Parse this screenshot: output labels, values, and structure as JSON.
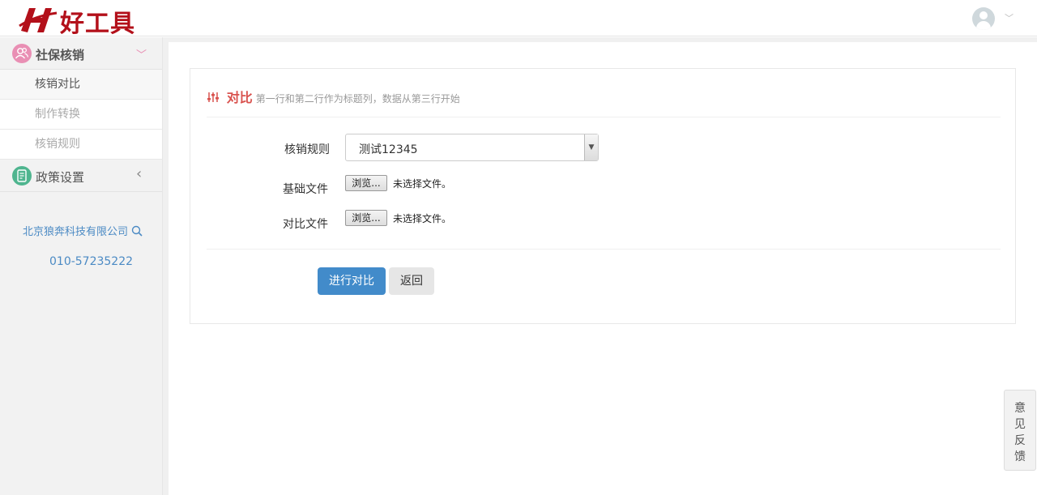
{
  "header": {
    "logo_text": "好工具",
    "logo_mark": "H"
  },
  "sidebar": {
    "groups": [
      {
        "label": "社保核销",
        "icon": "user-group-icon",
        "icon_color": "#e98fb4",
        "arrow": "﹀"
      },
      {
        "label": "政策设置",
        "icon": "document-icon",
        "icon_color": "#4fb58f",
        "arrow": "‹"
      }
    ],
    "items": [
      {
        "label": "核销对比",
        "active": true
      },
      {
        "label": "制作转换",
        "active": false
      },
      {
        "label": "核销规则",
        "active": false
      }
    ],
    "company": "北京狼奔科技有限公司",
    "phone": "010-57235222"
  },
  "panel": {
    "title": "对比",
    "subtitle": "第一行和第二行作为标题列，数据从第三行开始",
    "form": {
      "rule_label": "核销规则",
      "rule_value": "测试12345",
      "base_label": "基础文件",
      "compare_label": "对比文件",
      "browse_label": "浏览...",
      "no_file_text": "未选择文件。"
    },
    "buttons": {
      "submit": "进行对比",
      "back": "返回"
    }
  },
  "feedback": [
    "意",
    "见",
    "反",
    "馈"
  ],
  "colors": {
    "accent": "#428bca",
    "title_red": "#d9534f",
    "brand_red": "#b3101a",
    "link_blue": "#4b8ac4"
  }
}
